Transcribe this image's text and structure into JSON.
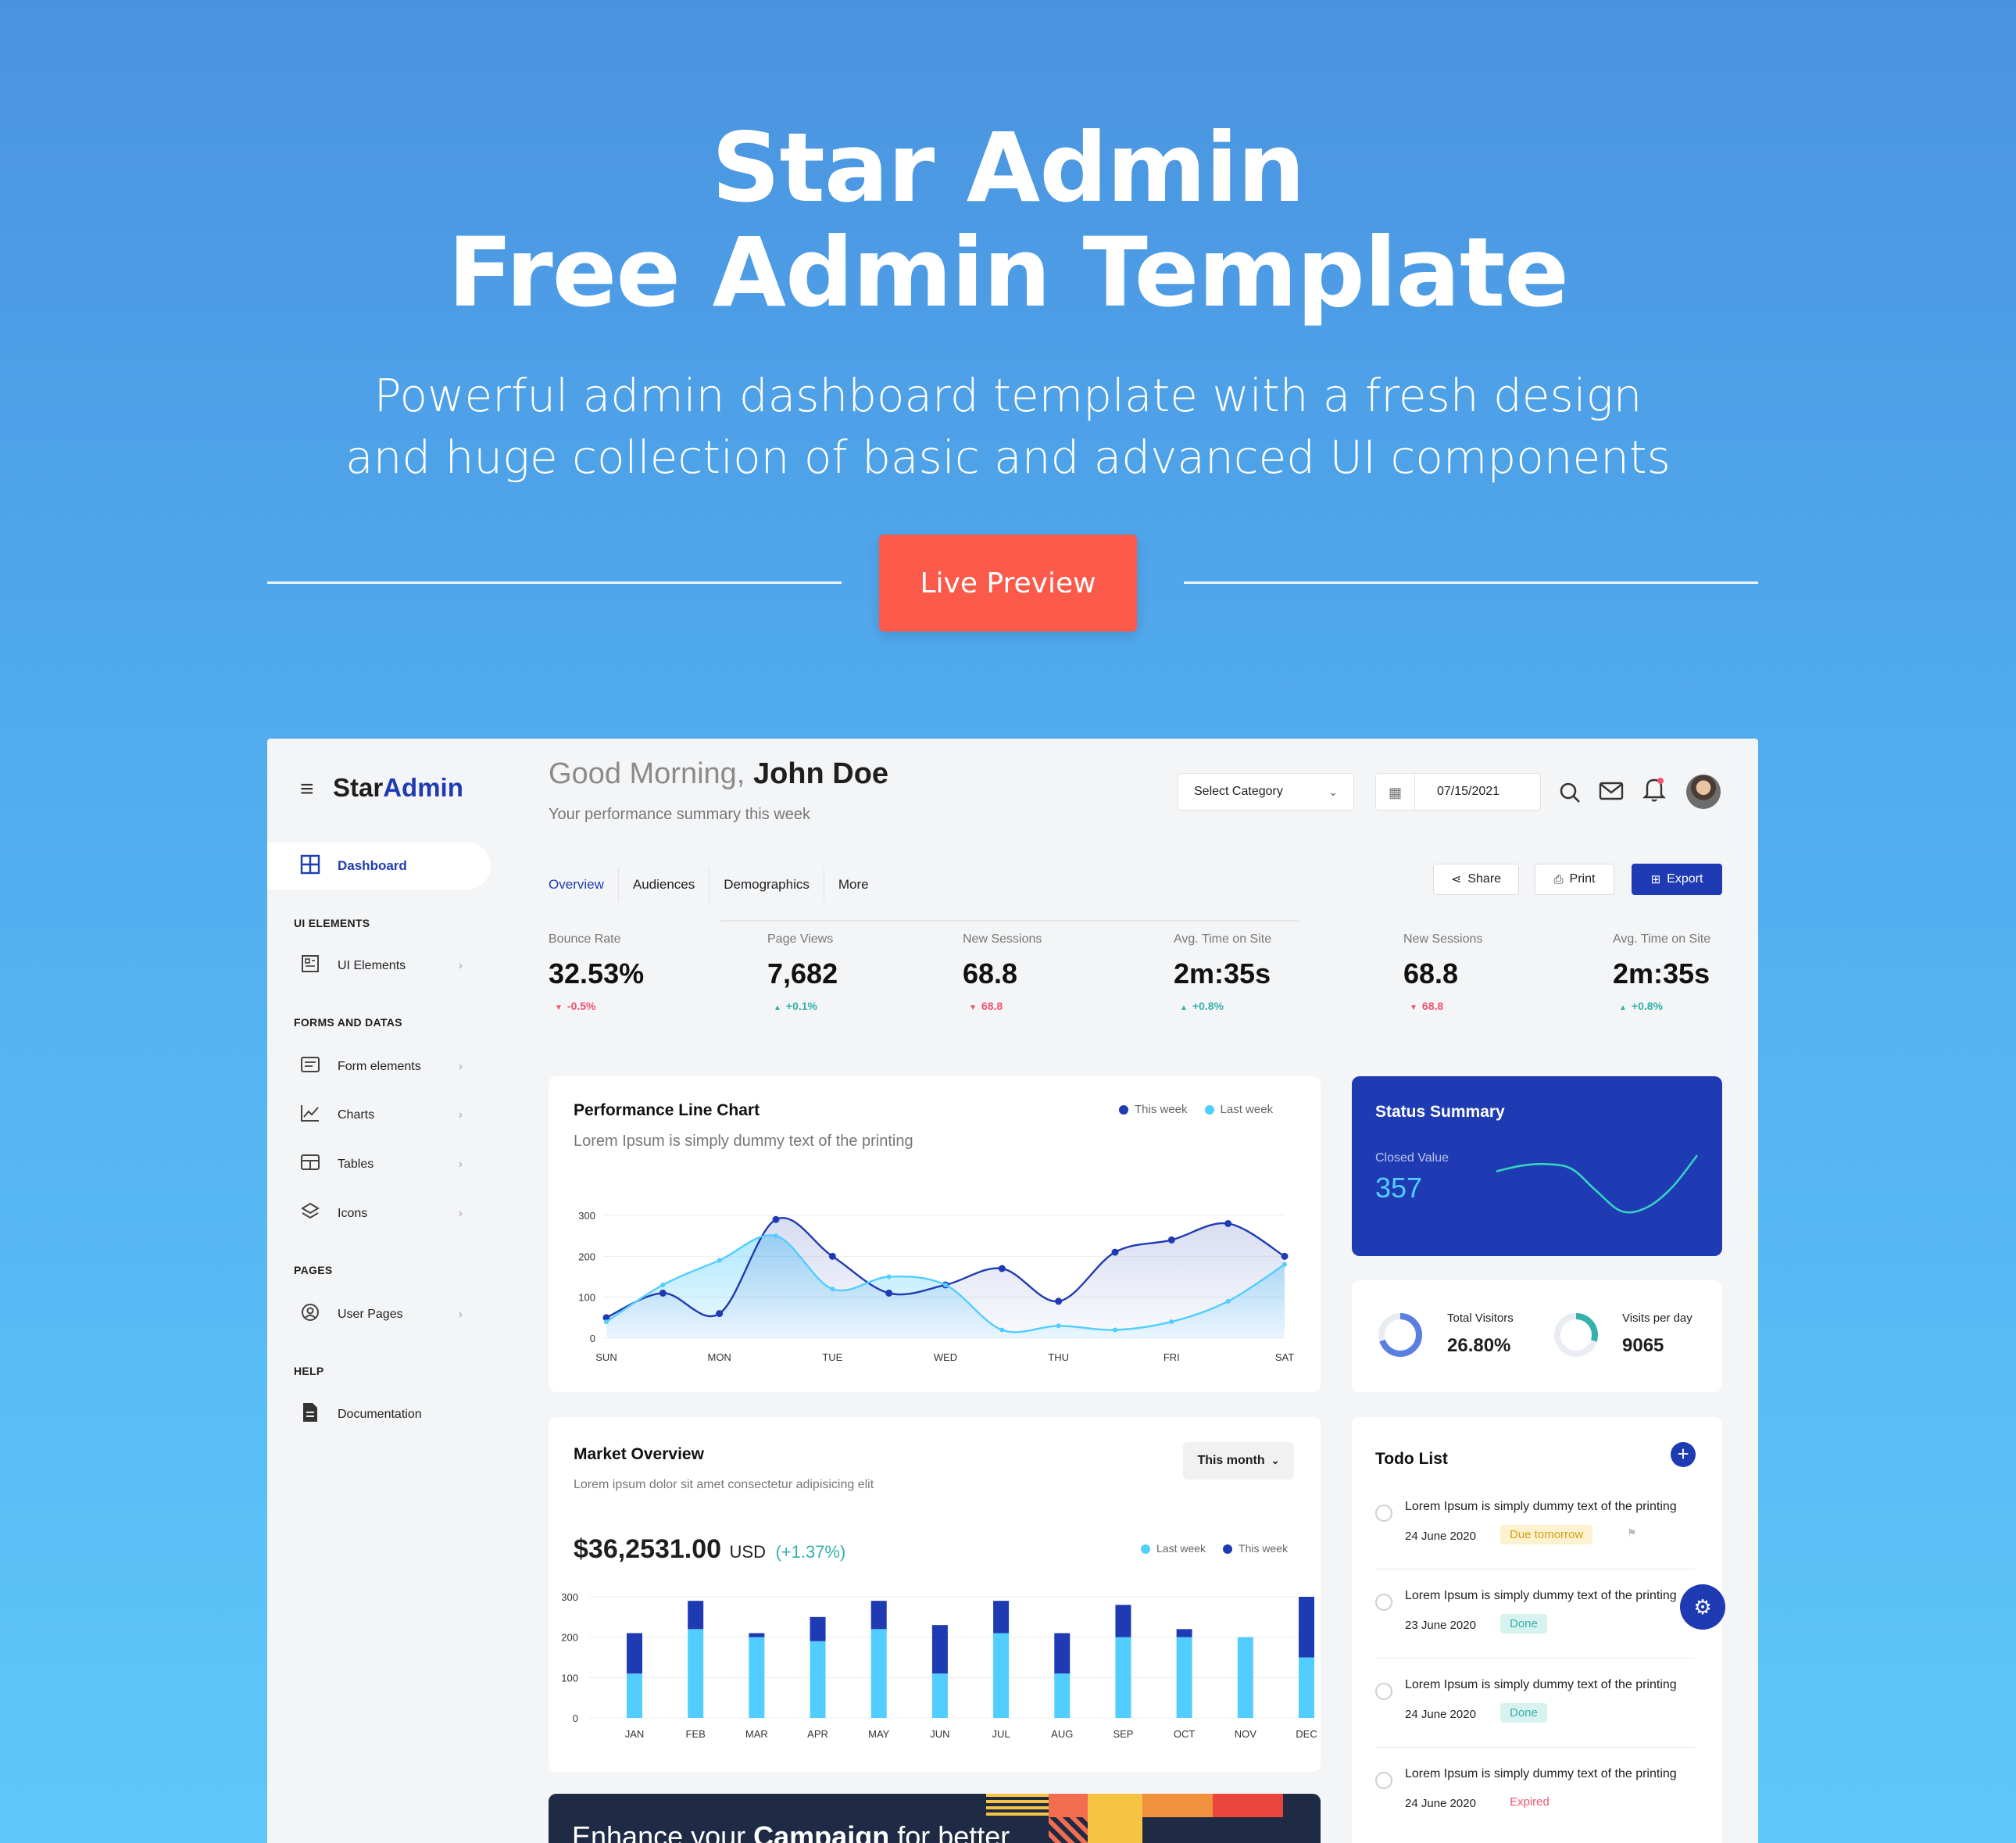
{
  "hero": {
    "title_line1": "Star Admin",
    "title_line2": "Free Admin Template",
    "subtitle_line1": "Powerful admin dashboard template with a fresh design",
    "subtitle_line2": "and huge collection of basic and advanced UI components",
    "cta_label": "Live Preview",
    "cta_color": "#fb5a4a"
  },
  "app": {
    "brand_main": "Star",
    "brand_accent": "Admin",
    "accent_color": "#1f3bb3",
    "sidebar": {
      "active": {
        "label": "Dashboard",
        "icon": "grid-icon"
      },
      "sections": [
        {
          "title": "UI ELEMENTS",
          "items": [
            {
              "label": "UI Elements",
              "icon": "layout-icon"
            }
          ]
        },
        {
          "title": "FORMS AND DATAS",
          "items": [
            {
              "label": "Form elements",
              "icon": "form-icon"
            },
            {
              "label": "Charts",
              "icon": "chart-icon"
            },
            {
              "label": "Tables",
              "icon": "table-icon"
            },
            {
              "label": "Icons",
              "icon": "layers-icon"
            }
          ]
        },
        {
          "title": "PAGES",
          "items": [
            {
              "label": "User Pages",
              "icon": "user-circle-icon"
            }
          ]
        },
        {
          "title": "HELP",
          "items": [
            {
              "label": "Documentation",
              "icon": "document-icon"
            }
          ]
        }
      ]
    },
    "header": {
      "greeting": "Good Morning,",
      "user_name": "John Doe",
      "subtitle": "Your performance summary this week",
      "category_placeholder": "Select Category",
      "date": "07/15/2021"
    },
    "tabs": [
      "Overview",
      "Audiences",
      "Demographics",
      "More"
    ],
    "actions": {
      "share": "Share",
      "print": "Print",
      "export": "Export"
    },
    "stats": [
      {
        "label": "Bounce Rate",
        "value": "32.53%",
        "change": "-0.5%",
        "trend": "down"
      },
      {
        "label": "Page Views",
        "value": "7,682",
        "change": "+0.1%",
        "trend": "up"
      },
      {
        "label": "New Sessions",
        "value": "68.8",
        "change": "68.8",
        "trend": "down"
      },
      {
        "label": "Avg. Time on Site",
        "value": "2m:35s",
        "change": "+0.8%",
        "trend": "up"
      },
      {
        "label": "New Sessions",
        "value": "68.8",
        "change": "68.8",
        "trend": "down"
      },
      {
        "label": "Avg. Time on Site",
        "value": "2m:35s",
        "change": "+0.8%",
        "trend": "up"
      }
    ],
    "performance": {
      "title": "Performance Line Chart",
      "subtitle": "Lorem Ipsum is simply dummy text of the printing",
      "legend_this": "This week",
      "legend_last": "Last week"
    },
    "status_summary": {
      "title": "Status Summary",
      "label": "Closed Value",
      "value": "357"
    },
    "visitors": {
      "total_label": "Total Visitors",
      "total_value": "26.80%",
      "total_fraction": 0.7,
      "per_day_label": "Visits per day",
      "per_day_value": "9065",
      "per_day_fraction": 0.3
    },
    "market": {
      "title": "Market Overview",
      "subtitle": "Lorem ipsum dolor sit amet consectetur adipisicing elit",
      "period": "This month",
      "amount": "$36,2531.00",
      "currency": "USD",
      "change": "(+1.37%)",
      "legend_last": "Last week",
      "legend_this": "This week"
    },
    "todo": {
      "title": "Todo List",
      "items": [
        {
          "text": "Lorem Ipsum is simply dummy text of the printing",
          "date": "24 June 2020",
          "status": "Due tomorrow",
          "kind": "due"
        },
        {
          "text": "Lorem Ipsum is simply dummy text of the printing",
          "date": "23 June 2020",
          "status": "Done",
          "kind": "done"
        },
        {
          "text": "Lorem Ipsum is simply dummy text of the printing",
          "date": "24 June 2020",
          "status": "Done",
          "kind": "done"
        },
        {
          "text": "Lorem Ipsum is simply dummy text of the printing",
          "date": "24 June 2020",
          "status": "Expired",
          "kind": "expired"
        }
      ]
    },
    "banner": {
      "text_pre": "Enhance your ",
      "text_bold": "Campaign",
      "text_post": " for better"
    }
  },
  "chart_data": [
    {
      "type": "line",
      "title": "Performance Line Chart",
      "x": [
        "SUN",
        "MON",
        "TUE",
        "WED",
        "THU",
        "FRI",
        "SAT"
      ],
      "ylim": [
        0,
        300
      ],
      "yticks": [
        0,
        100,
        200,
        300
      ],
      "series": [
        {
          "name": "This week",
          "color": "#1f3bb3",
          "x_pos": [
            0,
            0.5,
            1,
            1.5,
            2,
            2.5,
            3,
            3.5,
            4,
            4.5,
            5,
            5.5,
            6
          ],
          "values": [
            50,
            110,
            60,
            290,
            200,
            110,
            130,
            170,
            90,
            210,
            240,
            280,
            200
          ]
        },
        {
          "name": "Last week",
          "color": "#52cdff",
          "x_pos": [
            0,
            0.5,
            1,
            1.5,
            2,
            2.5,
            3,
            3.5,
            4,
            4.5,
            5,
            5.5,
            6
          ],
          "values": [
            40,
            130,
            190,
            250,
            120,
            150,
            130,
            20,
            30,
            20,
            40,
            90,
            180
          ]
        }
      ]
    },
    {
      "type": "bar",
      "title": "Market Overview",
      "categories": [
        "JAN",
        "FEB",
        "MAR",
        "APR",
        "MAY",
        "JUN",
        "JUL",
        "AUG",
        "SEP",
        "OCT",
        "NOV",
        "DEC"
      ],
      "ylim": [
        0,
        300
      ],
      "yticks": [
        0,
        100,
        200,
        300
      ],
      "stacked": true,
      "series": [
        {
          "name": "Last week",
          "color": "#52cdff",
          "values": [
            110,
            220,
            200,
            190,
            220,
            110,
            210,
            110,
            200,
            200,
            200,
            150
          ]
        },
        {
          "name": "This week",
          "color": "#1f3bb3",
          "values": [
            100,
            70,
            10,
            60,
            70,
            120,
            80,
            100,
            80,
            20,
            0,
            150
          ]
        }
      ]
    },
    {
      "type": "line",
      "title": "Status Summary",
      "x": [
        0,
        1,
        2,
        3,
        4,
        5,
        6,
        7,
        8
      ],
      "series": [
        {
          "name": "Closed Value",
          "color": "#34d3c2",
          "values": [
            55,
            62,
            64,
            58,
            30,
            5,
            10,
            35,
            75
          ]
        }
      ]
    }
  ]
}
